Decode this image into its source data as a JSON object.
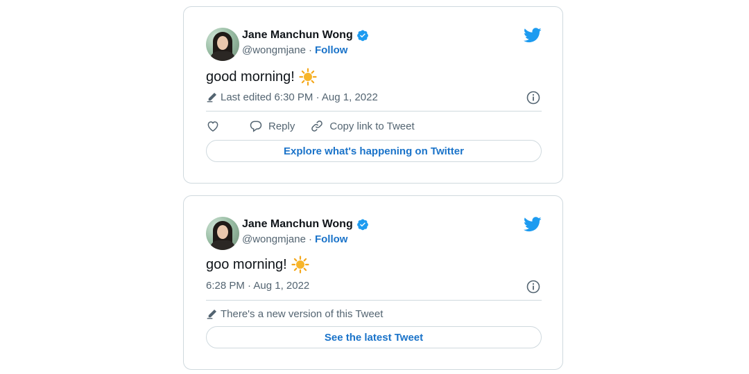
{
  "tweets": [
    {
      "author": {
        "name": "Jane Manchun Wong",
        "handle": "@wongmjane",
        "separator": "·",
        "follow_label": "Follow"
      },
      "text": "good morning!",
      "meta": "Last edited 6:30 PM · Aug 1, 2022",
      "actions": {
        "reply_label": "Reply",
        "copy_link_label": "Copy link to Tweet"
      },
      "button_label": "Explore what's happening on Twitter"
    },
    {
      "author": {
        "name": "Jane Manchun Wong",
        "handle": "@wongmjane",
        "separator": "·",
        "follow_label": "Follow"
      },
      "text": "goo morning!",
      "meta": "6:28 PM · Aug 1, 2022",
      "notice": "There's a new version of this Tweet",
      "button_label": "See the latest Tweet"
    }
  ],
  "icons": {
    "brand": "twitter-bird-icon",
    "verified": "verified-badge-icon",
    "emoji": "sun-emoji-icon",
    "edit": "pencil-icon",
    "info": "info-icon",
    "like": "heart-icon",
    "reply": "reply-bubble-icon",
    "link": "link-icon"
  },
  "colors": {
    "accent": "#1d9bf0",
    "link": "#1a73c9",
    "muted": "#536471",
    "border": "#cfd9de",
    "sun": "#f4a81d"
  }
}
